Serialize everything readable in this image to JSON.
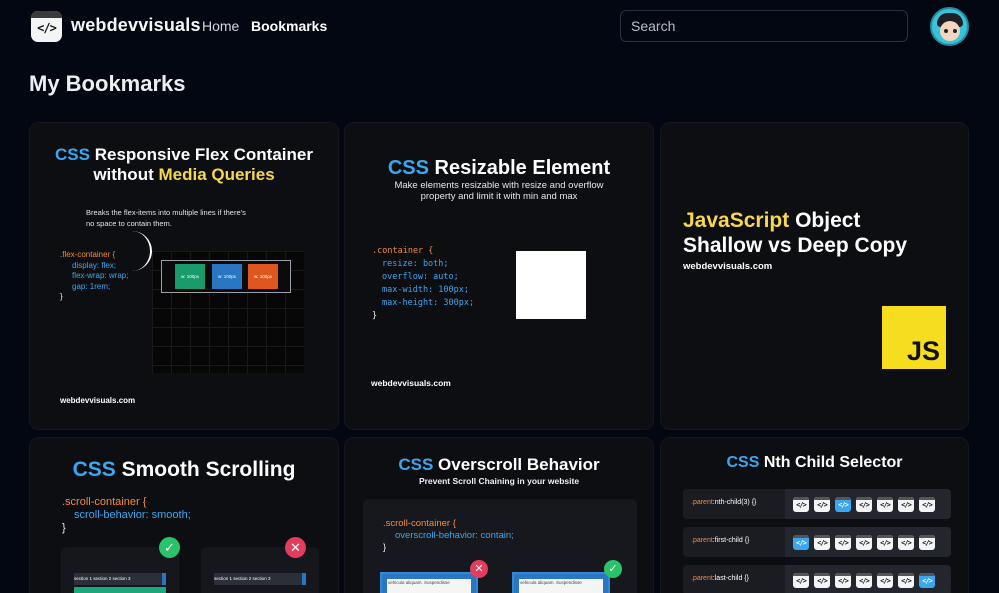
{
  "nav": {
    "brand": "webdevvisuals",
    "logo_glyph": "</>",
    "home": "Home",
    "bookmarks": "Bookmarks",
    "search_placeholder": "Search"
  },
  "page": {
    "title": "My Bookmarks"
  },
  "cards": [
    {
      "title_part1": "CSS",
      "title_part2": " Responsive Flex Container",
      "title_line2a": "without ",
      "title_line2b": "Media Queries",
      "note": "Breaks the flex-items into multiple lines if there's no space to contain them.",
      "code": [
        ".flex-container {",
        "display: flex;",
        "flex-wrap: wrap;",
        "gap: 1rem;",
        "}"
      ],
      "box_label": "w: 100px",
      "footer": "webdevvisuals.com"
    },
    {
      "title_part1": "CSS",
      "title_part2": " Resizable Element",
      "subtitle_line1": "Make elements resizable with resize and overflow",
      "subtitle_line2": "property and limit it with min and max",
      "code": [
        ".container {",
        "resize: both;",
        "overflow: auto;",
        "max-width: 100px;",
        "max-height: 300px;",
        "}"
      ],
      "footer": "webdevvisuals.com"
    },
    {
      "title_part1": "JavaScript",
      "title_part2": " Object",
      "title_line2": "Shallow vs Deep Copy",
      "subtitle": "webdevvisuals.com",
      "logo_text": "JS"
    },
    {
      "title_part1": "CSS",
      "title_part2": " Smooth Scrolling",
      "code": [
        ".scroll-container {",
        "scroll-behavior: smooth;",
        "}"
      ],
      "tabs_text": "section 1   section 2   section 3"
    },
    {
      "title_part1": "CSS",
      "title_part2": " Overscroll Behavior",
      "subtitle": "Prevent Scroll Chaining in your website",
      "code": [
        ".scroll-container {",
        "overscroll-behavior: contain;",
        "}"
      ],
      "window_text": "vehicula aliquam. Suspendisse"
    },
    {
      "title_part1": "CSS",
      "title_part2": " Nth Child Selector",
      "rows": [
        {
          "sel": ".parent",
          "rest": ":nth-child(3) {}"
        },
        {
          "sel": ".parent",
          "rest": ":first-child {}"
        },
        {
          "sel": ".parent",
          "rest": ":last-child {}"
        }
      ],
      "cell_glyph": "</>"
    }
  ],
  "colors": {
    "background": "#030711",
    "accent_blue": "#3ba7f0",
    "accent_yellow": "#f7d84a",
    "card": "#0d0e12"
  }
}
